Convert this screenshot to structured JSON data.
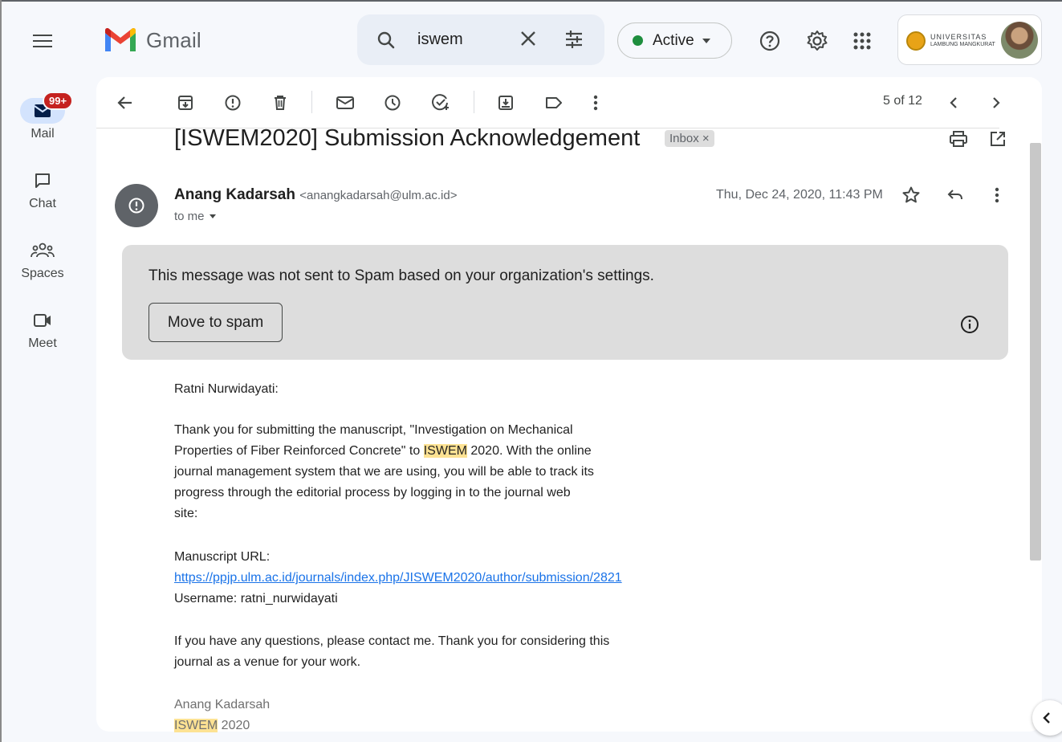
{
  "header": {
    "app_name": "Gmail",
    "search": {
      "value": "iswem"
    },
    "status": {
      "label": "Active",
      "color": "#1e8e3e"
    },
    "account": {
      "org_line1": "UNIVERSITAS",
      "org_line2": "LAMBUNG MANGKURAT"
    }
  },
  "rail": {
    "items": [
      {
        "label": "Mail",
        "badge": "99+",
        "active": true
      },
      {
        "label": "Chat"
      },
      {
        "label": "Spaces"
      },
      {
        "label": "Meet"
      }
    ]
  },
  "toolbar": {
    "pager": "5 of 12"
  },
  "email": {
    "subject": "[ISWEM2020] Submission Acknowledgement",
    "label": "Inbox ×",
    "sender_name": "Anang Kadarsah",
    "sender_email": "<anangkadarsah@ulm.ac.id>",
    "to": "to me",
    "date": "Thu, Dec 24, 2020, 11:43 PM",
    "warning_text": "This message was not sent to Spam based on your organization's settings.",
    "spam_button": "Move to spam",
    "body": {
      "greeting": "Ratni Nurwidayati:",
      "p1_a": "Thank you for submitting the manuscript, \"Investigation on Mechanical",
      "p1_b": "Properties of Fiber Reinforced Concrete\" to ",
      "p1_hl": "ISWEM",
      "p1_c": " 2020. With the online",
      "p1_d": "journal management system that we are using, you will be able to track its",
      "p1_e": "progress through the editorial process by logging in to the journal web",
      "p1_f": "site:",
      "url_label": "Manuscript URL:",
      "url": "https://ppjp.ulm.ac.id/journals/index.php/JISWEM2020/author/submission/2821",
      "username": "Username: ratni_nurwidayati",
      "p3_a": "If you have any questions, please contact me. Thank you for considering this",
      "p3_b": "journal as a venue for your work.",
      "sig_name": "Anang Kadarsah",
      "sig_hl": "ISWEM",
      "sig_year": " 2020"
    }
  },
  "colors": {
    "accent": "#1a73e8",
    "badge": "#c5221f",
    "highlight": "#fde293"
  }
}
